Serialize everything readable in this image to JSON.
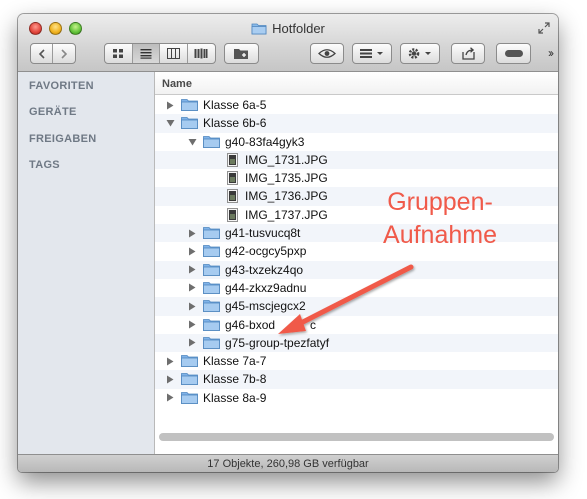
{
  "window": {
    "title": "Hotfolder"
  },
  "toolbar": {
    "back_icon": "chevron-left-icon",
    "forward_icon": "chevron-right-icon",
    "views": [
      "icon-view",
      "list-view",
      "column-view",
      "coverflow-view"
    ],
    "active_view": "list-view"
  },
  "sidebar": {
    "sections": [
      "FAVORITEN",
      "GERÄTE",
      "FREIGABEN",
      "TAGS"
    ]
  },
  "list": {
    "column_header": "Name",
    "rows": [
      {
        "label": "Klasse 6a-5",
        "level": 0,
        "type": "folder",
        "expanded": false
      },
      {
        "label": "Klasse 6b-6",
        "level": 0,
        "type": "folder",
        "expanded": true
      },
      {
        "label": "g40-83fa4gyk3",
        "level": 1,
        "type": "folder",
        "expanded": true
      },
      {
        "label": "IMG_1731.JPG",
        "level": 2,
        "type": "file"
      },
      {
        "label": "IMG_1735.JPG",
        "level": 2,
        "type": "file"
      },
      {
        "label": "IMG_1736.JPG",
        "level": 2,
        "type": "file"
      },
      {
        "label": "IMG_1737.JPG",
        "level": 2,
        "type": "file"
      },
      {
        "label": "g41-tusvucq8t",
        "level": 1,
        "type": "folder",
        "expanded": false
      },
      {
        "label": "g42-ocgcy5pxp",
        "level": 1,
        "type": "folder",
        "expanded": false
      },
      {
        "label": "g43-txzekz4qo",
        "level": 1,
        "type": "folder",
        "expanded": false
      },
      {
        "label": "g44-zkxz9adnu",
        "level": 1,
        "type": "folder",
        "expanded": false
      },
      {
        "label": "g45-mscjegcx2",
        "level": 1,
        "type": "folder",
        "expanded": false
      },
      {
        "label": "g46-bxod",
        "suffix": "c",
        "level": 1,
        "type": "folder",
        "expanded": false
      },
      {
        "label": "g75-group-tpezfatyf",
        "level": 1,
        "type": "folder",
        "expanded": false
      },
      {
        "label": "Klasse 7a-7",
        "level": 0,
        "type": "folder",
        "expanded": false
      },
      {
        "label": "Klasse 7b-8",
        "level": 0,
        "type": "folder",
        "expanded": false
      },
      {
        "label": "Klasse 8a-9",
        "level": 0,
        "type": "folder",
        "expanded": false
      }
    ]
  },
  "status": {
    "text": "17 Objekte, 260,98 GB verfügbar"
  },
  "annotation": {
    "line1": "Gruppen-",
    "line2": "Aufnahme",
    "color": "#f05a4a"
  },
  "colors": {
    "folder": "#7fb3e8",
    "sidebar_bg": "#e3e7ed",
    "row_alt": "#f2f5fa"
  }
}
